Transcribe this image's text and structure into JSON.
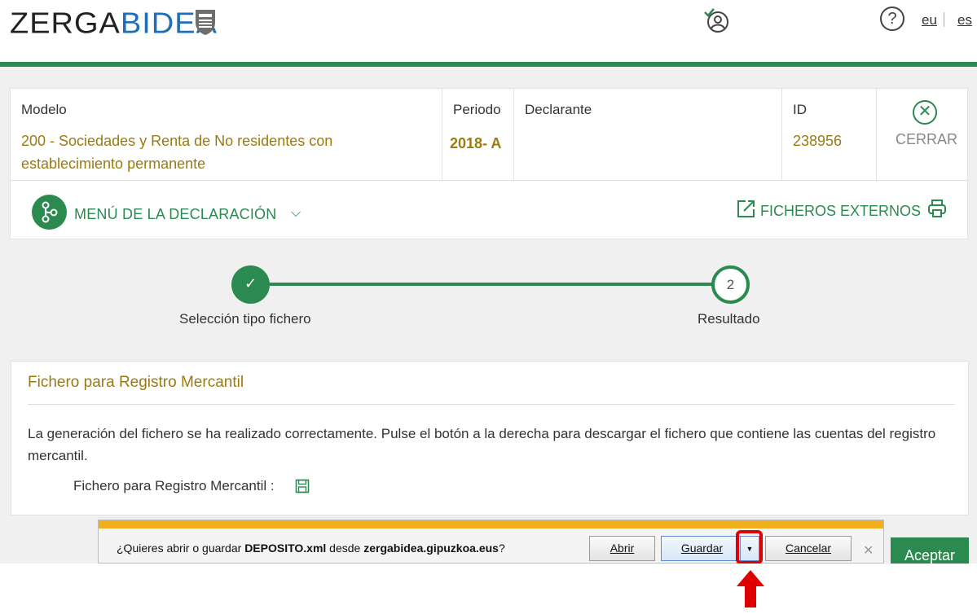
{
  "header": {
    "logo_part1": "ZERGA",
    "logo_part2": "BIDEA",
    "help_symbol": "?",
    "lang_eu": "eu",
    "lang_es": "es",
    "icons": [
      "shield-logo-icon",
      "user-check-icon",
      "help-icon"
    ]
  },
  "declaration": {
    "modelo_label": "Modelo",
    "modelo_value": "200 - Sociedades y Renta de No residentes con establecimiento permanente",
    "periodo_label": "Periodo",
    "periodo_value": "2018- A",
    "declarante_label": "Declarante",
    "declarante_value": "",
    "id_label": "ID",
    "id_value": "238956",
    "cerrar_label": "CERRAR",
    "cerrar_symbol": "✕"
  },
  "menu": {
    "menu_label": "MENÚ DE LA DECLARACIÓN",
    "chevron": "⌵",
    "external_files_label": "FICHEROS EXTERNOS"
  },
  "stepper": {
    "step1_symbol": "✓",
    "step1_label": "Selección tipo fichero",
    "step2_number": "2",
    "step2_label": "Resultado"
  },
  "result": {
    "title": "Fichero para Registro Mercantil",
    "message": "La generación del fichero se ha realizado correctamente. Pulse el botón a la derecha para descargar el fichero que contiene las cuentas del registro mercantil.",
    "file_label": "Fichero para Registro Mercantil :"
  },
  "download_bar": {
    "prompt_prefix": "¿Quieres abrir o guardar ",
    "file_name": "DEPOSITO.xml",
    "prompt_middle": " desde ",
    "source": "zergabidea.gipuzkoa.eus",
    "prompt_suffix": "?",
    "open_label": "Abrir",
    "save_label": "Guardar",
    "arrow_symbol": "▼",
    "cancel_label": "Cancelar",
    "close_symbol": "✕"
  },
  "footer": {
    "accept_label": "Aceptar"
  },
  "colors": {
    "brand_green": "#2b8a4f",
    "value_gold": "#9b7a12",
    "logo_blue": "#1e6fb8",
    "notification_yellow": "#f2b01e",
    "highlight_red": "#e00000"
  }
}
